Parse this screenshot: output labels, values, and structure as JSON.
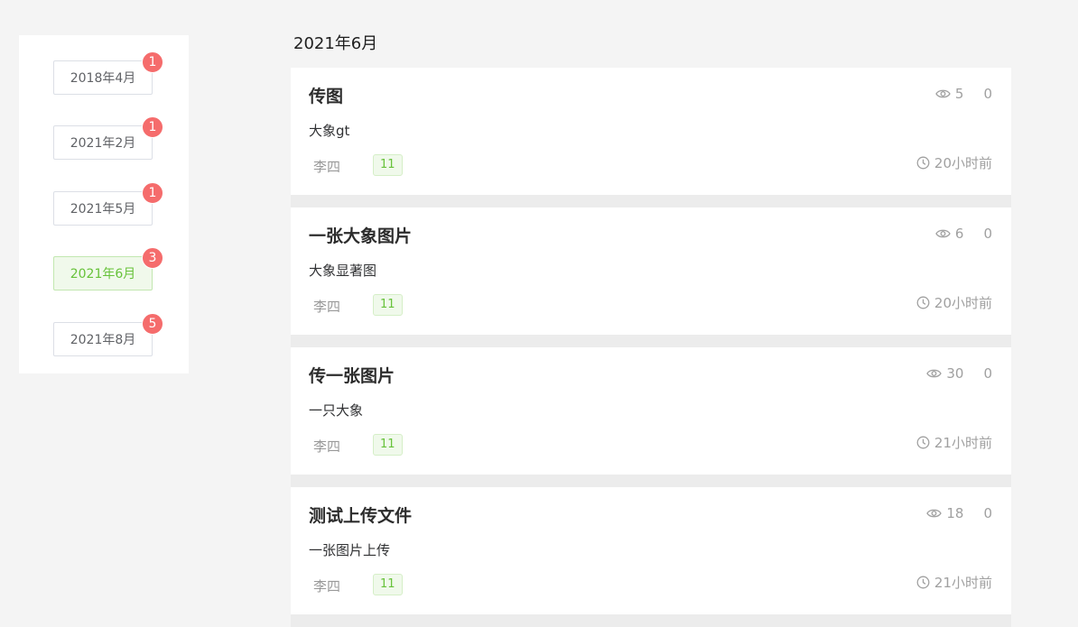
{
  "sidebar": {
    "months": [
      {
        "label": "2018年4月",
        "count": "1",
        "active": false
      },
      {
        "label": "2021年2月",
        "count": "1",
        "active": false
      },
      {
        "label": "2021年5月",
        "count": "1",
        "active": false
      },
      {
        "label": "2021年6月",
        "count": "3",
        "active": true
      },
      {
        "label": "2021年8月",
        "count": "5",
        "active": false
      }
    ]
  },
  "main": {
    "heading": "2021年6月",
    "posts": [
      {
        "title": "传图",
        "desc": "大象gt",
        "author": "李四",
        "tag": "11",
        "views": "5",
        "comments": "0",
        "time": "20小时前"
      },
      {
        "title": "一张大象图片",
        "desc": "大象显著图",
        "author": "李四",
        "tag": "11",
        "views": "6",
        "comments": "0",
        "time": "20小时前"
      },
      {
        "title": "传一张图片",
        "desc": "一只大象",
        "author": "李四",
        "tag": "11",
        "views": "30",
        "comments": "0",
        "time": "21小时前"
      },
      {
        "title": "测试上传文件",
        "desc": "一张图片上传",
        "author": "李四",
        "tag": "11",
        "views": "18",
        "comments": "0",
        "time": "21小时前"
      }
    ]
  },
  "icons": {
    "views": "eye-icon",
    "time": "clock-icon"
  },
  "colors": {
    "badge": "#f56c6c",
    "active_bg": "#f0f9eb",
    "active_text": "#67c23a",
    "tag_text": "#67c23a",
    "page_bg": "#f4f4f4"
  }
}
